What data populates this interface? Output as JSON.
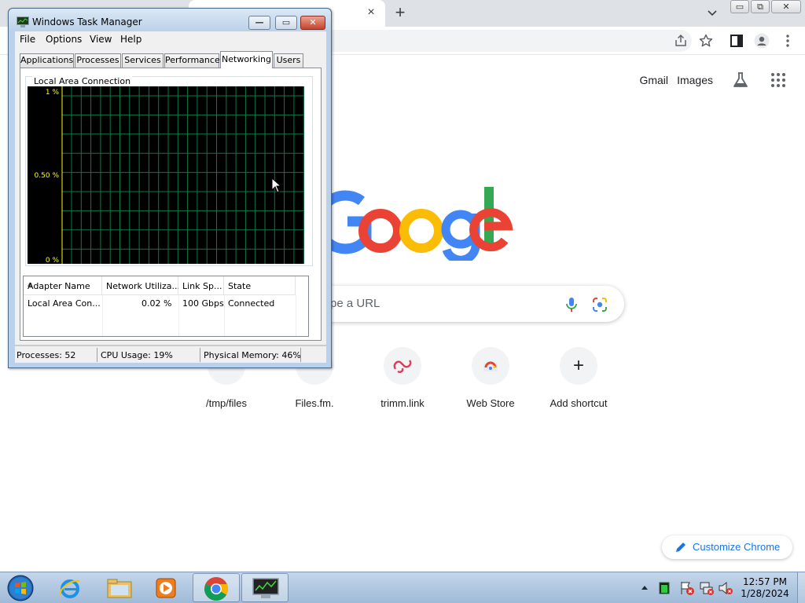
{
  "browser": {
    "tab_close_glyph": "×",
    "new_tab_glyph": "+",
    "window_buttons": {
      "minimize": "▭",
      "maximize": "⧉",
      "close": "✕"
    },
    "links": {
      "gmail": "Gmail",
      "images": "Images"
    },
    "search": {
      "placeholder_visible": "pe a URL"
    },
    "shortcuts": [
      {
        "label": "/tmp/files",
        "icon": "files-icon"
      },
      {
        "label": "Files.fm.",
        "icon": "files-fm-icon"
      },
      {
        "label": "trimm.link",
        "icon": "trimm-link-icon"
      },
      {
        "label": "Web Store",
        "icon": "web-store-icon"
      },
      {
        "label": "Add shortcut",
        "icon": "plus-icon",
        "glyph": "+"
      }
    ],
    "customize_label": "Customize Chrome",
    "logo_colors": {
      "blue": "#4285f4",
      "red": "#ea4335",
      "yellow": "#fbbc05",
      "green": "#34a853"
    }
  },
  "taskmanager": {
    "title": "Windows Task Manager",
    "controls": {
      "minimize": "—",
      "maximize": "▭",
      "close": "✕"
    },
    "menu": [
      "File",
      "Options",
      "View",
      "Help"
    ],
    "tabs": [
      "Applications",
      "Processes",
      "Services",
      "Performance",
      "Networking",
      "Users"
    ],
    "active_tab": "Networking",
    "graph": {
      "title": "Local Area Connection",
      "scale_labels": {
        "top": "1 %",
        "mid": "0.50 %",
        "bottom": "0 %"
      },
      "colors": {
        "background": "#000000",
        "grid": "#0b7a45",
        "axis_label": "#ffff00",
        "trace": "#ffff00"
      }
    },
    "adapter_table": {
      "columns": [
        "Adapter Name",
        "Network Utiliza...",
        "Link Sp...",
        "State"
      ],
      "rows": [
        {
          "adapter": "Local Area Con...",
          "utilization": "0.02 %",
          "link_speed": "100 Gbps",
          "state": "Connected"
        }
      ]
    },
    "status": {
      "processes": "Processes: 52",
      "cpu": "CPU Usage: 19%",
      "memory": "Physical Memory: 46%"
    }
  },
  "taskbar": {
    "pinned": [
      "start-orb",
      "internet-explorer-icon",
      "explorer-icon",
      "media-player-icon",
      "chrome-icon",
      "task-manager-icon"
    ],
    "clock": {
      "time": "12:57 PM",
      "date": "1/28/2024"
    }
  }
}
